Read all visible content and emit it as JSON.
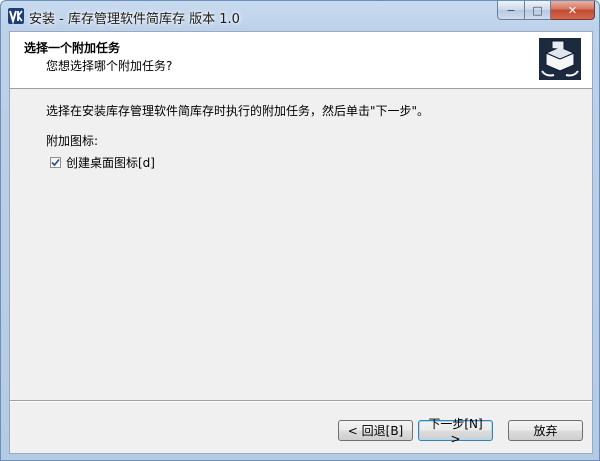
{
  "window": {
    "title": "安装 - 库存管理软件简库存 版本 1.0",
    "caption_buttons": {
      "minimize": "−",
      "maximize": "□",
      "close": "✕"
    }
  },
  "header": {
    "title": "选择一个附加任务",
    "subtitle": "您想选择哪个附加任务?"
  },
  "body": {
    "instruction": "选择在安装库存管理软件简库存时执行的附加任务，然后单击\"下一步\"。",
    "group_label": "附加图标:",
    "tasks": [
      {
        "label": "创建桌面图标[d]",
        "checked": true
      }
    ]
  },
  "buttons": {
    "back": "< 回退[B]",
    "next": "下一步[N] >",
    "cancel": "放弃"
  },
  "icons": {
    "app": "app-logo-icon",
    "wizard": "installer-box-icon"
  }
}
